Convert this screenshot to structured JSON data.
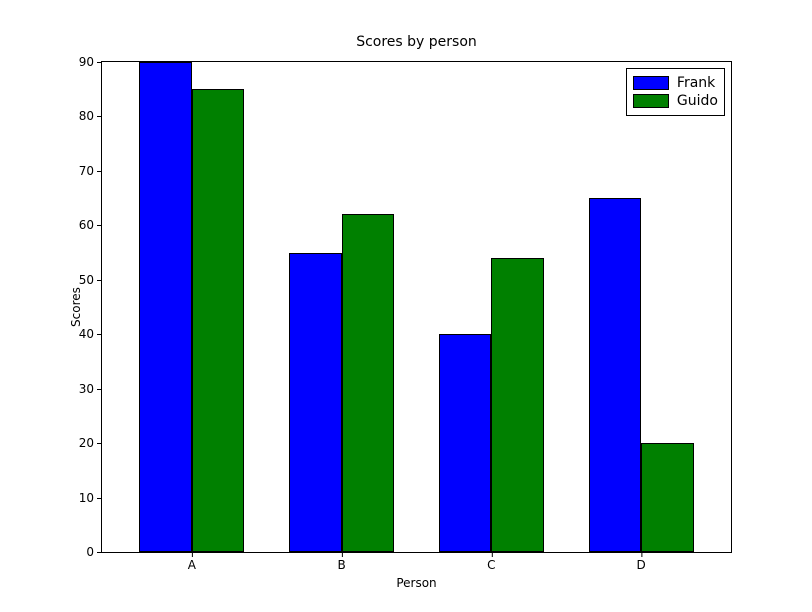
{
  "chart_data": {
    "type": "bar",
    "title": "Scores by person",
    "xlabel": "Person",
    "ylabel": "Scores",
    "categories": [
      "A",
      "B",
      "C",
      "D"
    ],
    "series": [
      {
        "name": "Frank",
        "color": "#0000ff",
        "values": [
          90,
          55,
          40,
          65
        ]
      },
      {
        "name": "Guido",
        "color": "#008000",
        "values": [
          85,
          62,
          54,
          20
        ]
      }
    ],
    "ylim": [
      0,
      90
    ],
    "yticks": [
      0,
      10,
      20,
      30,
      40,
      50,
      60,
      70,
      80,
      90
    ],
    "legend_position": "upper-right"
  }
}
